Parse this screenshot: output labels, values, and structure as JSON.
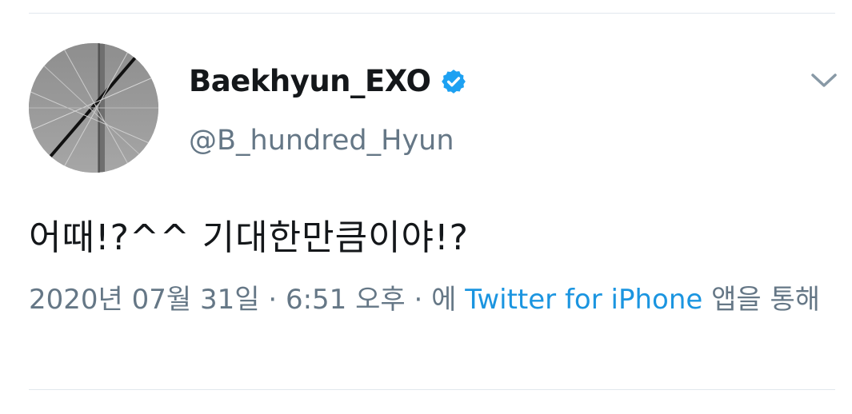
{
  "tweet": {
    "author": {
      "display_name": "Baekhyun_EXO",
      "handle": "@B_hundred_Hyun",
      "verified_icon": "verified-badge-icon"
    },
    "menu_icon": "chevron-down-icon",
    "text": "어때!?^^ 기대한만큼이야!?",
    "meta": {
      "date": "2020년 07월 31일",
      "separator": "·",
      "time": "6:51 오후",
      "source_prefix": "에",
      "source_link": "Twitter for iPhone",
      "source_suffix": "앱을 통해"
    }
  },
  "colors": {
    "text_primary": "#14171a",
    "text_secondary": "#657786",
    "link": "#1b95e0",
    "verified": "#1da1f2",
    "divider": "#e1e8ed"
  }
}
